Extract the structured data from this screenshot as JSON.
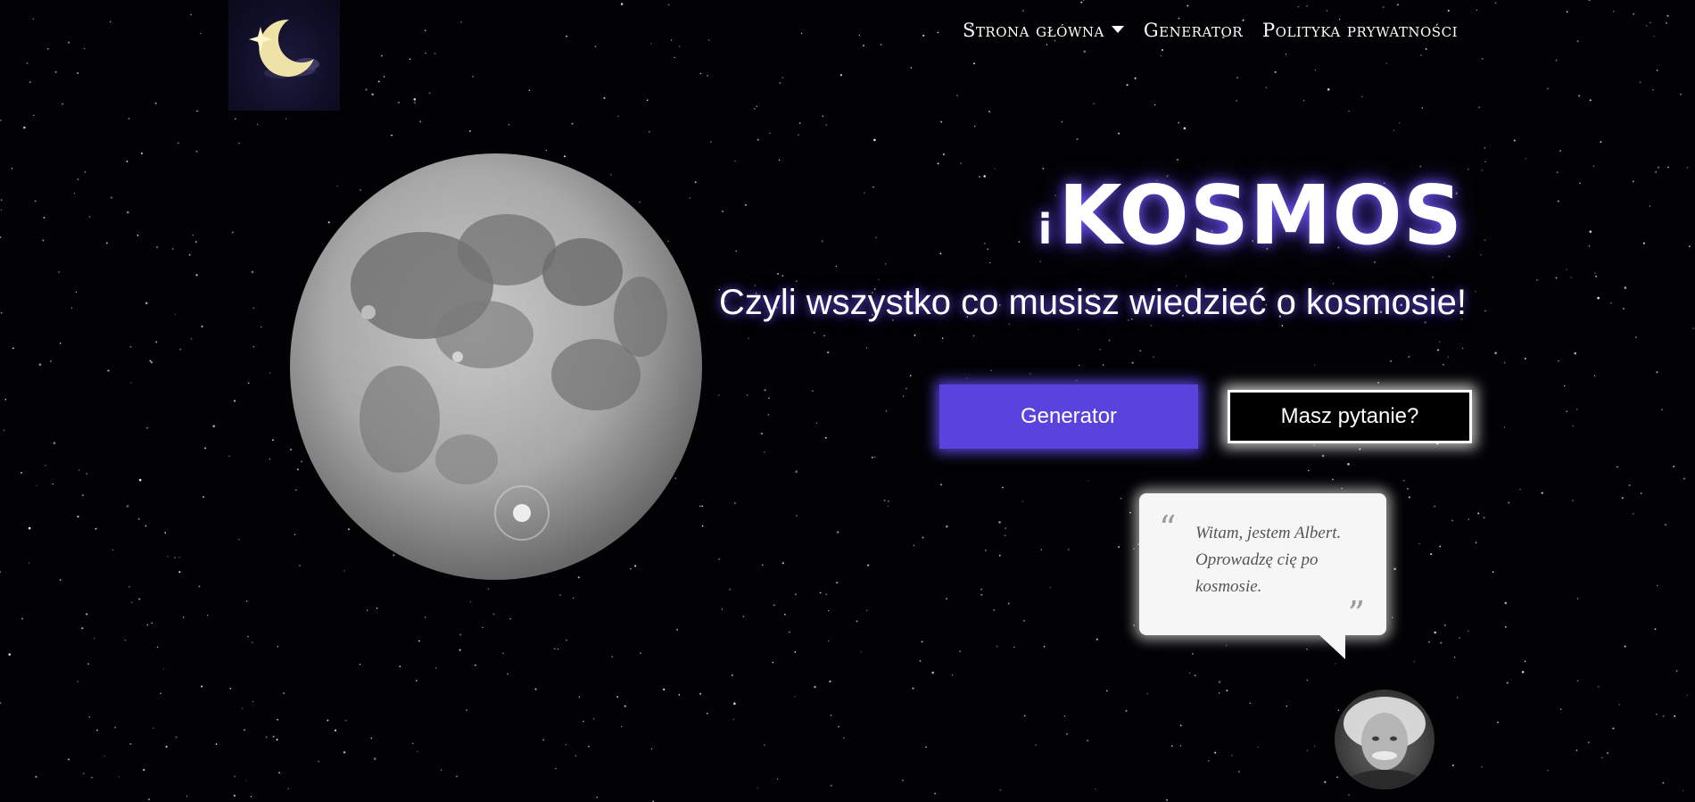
{
  "nav": {
    "items": [
      {
        "label": "Strona główna",
        "has_dropdown": true
      },
      {
        "label": "Generator",
        "has_dropdown": false
      },
      {
        "label": "Polityka prywatności",
        "has_dropdown": false
      }
    ]
  },
  "logo": {
    "icon": "crescent-moon-star-icon"
  },
  "hero": {
    "title_prefix": "i",
    "title_main": "KOSMOS",
    "subtitle": "Czyli wszystko co musisz wiedzieć o kosmosie!"
  },
  "buttons": {
    "generator": "Generator",
    "question": "Masz pytanie?"
  },
  "bubble": {
    "open_quote": "“",
    "close_quote": "”",
    "text": "Witam, jestem Albert. Oprowadzę cię po kosmosie."
  },
  "colors": {
    "accent": "#5a43dc",
    "background": "#020204",
    "glow": "#6e50ff"
  },
  "avatar": {
    "icon": "albert-portrait"
  }
}
